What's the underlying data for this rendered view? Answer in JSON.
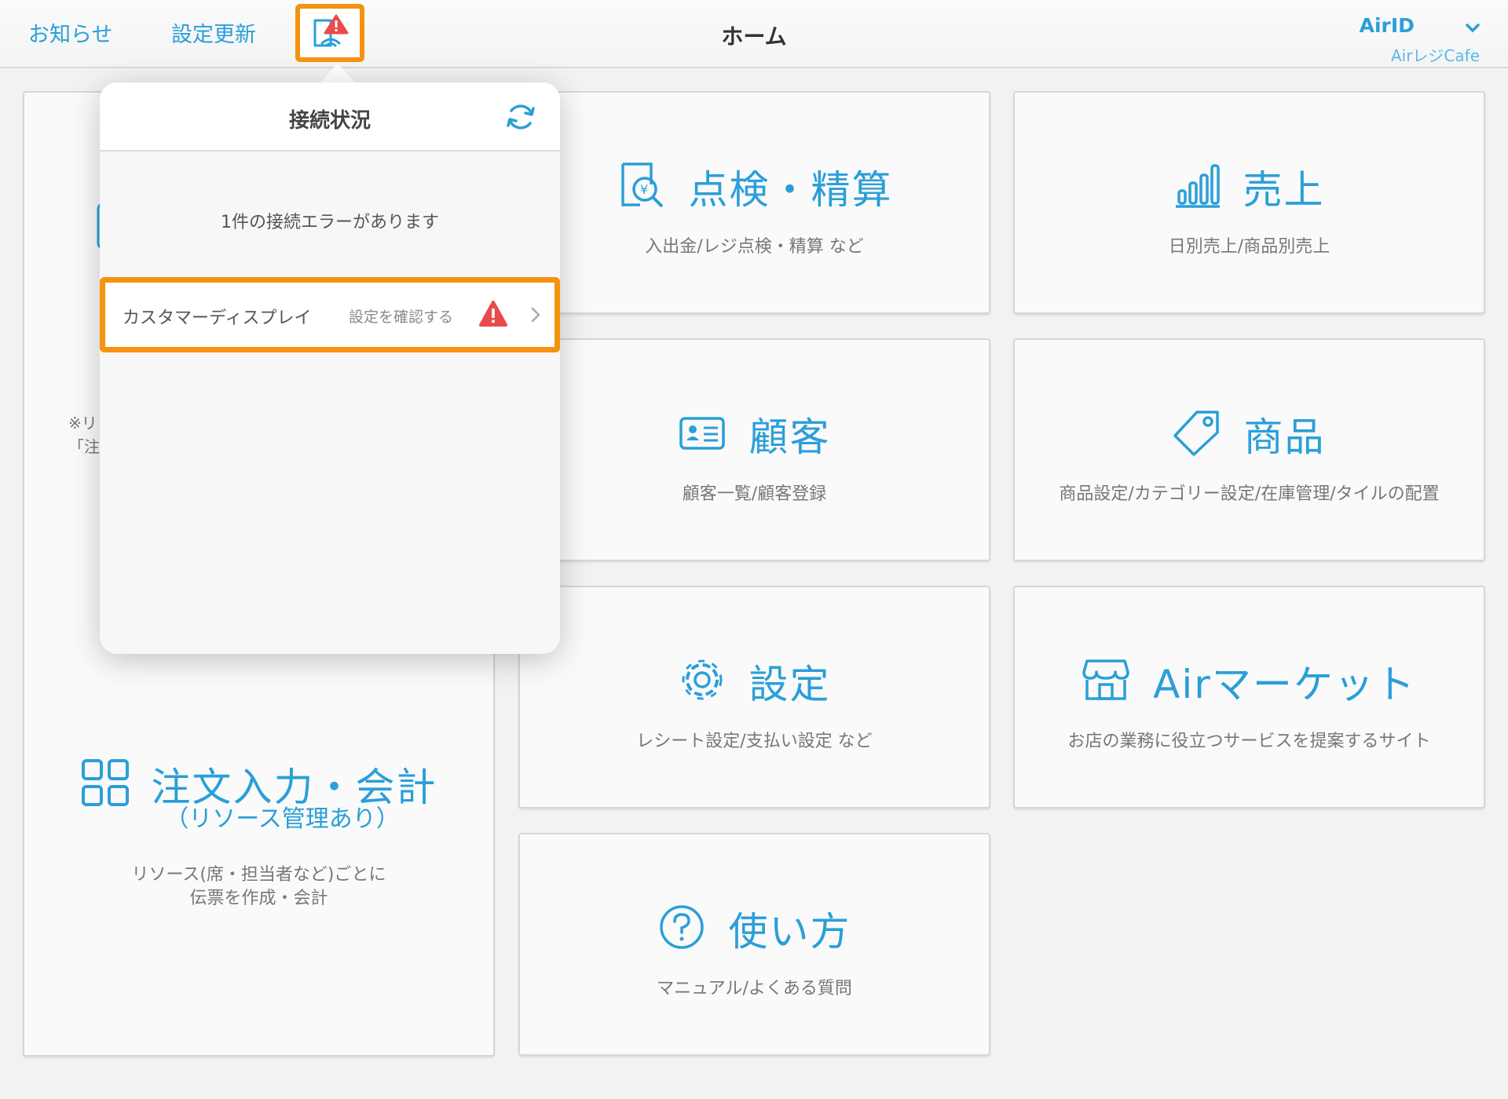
{
  "header": {
    "news_label": "お知らせ",
    "update_label": "設定更新",
    "title": "ホーム",
    "account_id": "AirID",
    "store_name": "AirレジCafe"
  },
  "popover": {
    "title": "接続状況",
    "message": "1件の接続エラーがあります",
    "items": [
      {
        "name": "カスタマーディスプレイ",
        "action": "設定を確認する"
      }
    ]
  },
  "tiles": {
    "order": {
      "title": "注文入力・会計",
      "subtitle": "（リソース管理あり）",
      "desc_line1": "リソース(席・担当者など)ごとに",
      "desc_line2": "伝票を作成・会計",
      "partial_line1": "※リ",
      "partial_line2": "「注"
    },
    "inspection": {
      "title": "点検・精算",
      "desc": "入出金/レジ点検・精算 など"
    },
    "sales": {
      "title": "売上",
      "desc": "日別売上/商品別売上"
    },
    "customer": {
      "title": "顧客",
      "desc": "顧客一覧/顧客登録"
    },
    "product": {
      "title": "商品",
      "desc": "商品設定/カテゴリー設定/在庫管理/タイルの配置"
    },
    "settings": {
      "title": "設定",
      "desc": "レシート設定/支払い設定 など"
    },
    "market": {
      "title": "Airマーケット",
      "desc": "お店の業務に役立つサービスを提案するサイト"
    },
    "howto": {
      "title": "使い方",
      "desc": "マニュアル/よくある質問"
    }
  },
  "colors": {
    "accent": "#2a9fd8",
    "highlight": "#f5920f",
    "error": "#e94b4b"
  },
  "icons": [
    "connection-status-icon",
    "chevron-down-icon",
    "refresh-icon",
    "warning-icon",
    "chevron-right-icon",
    "register-receipt-icon",
    "bar-chart-icon",
    "customer-card-icon",
    "tag-icon",
    "gear-icon",
    "store-icon",
    "help-icon",
    "grid-icon",
    "tablet-icon"
  ]
}
